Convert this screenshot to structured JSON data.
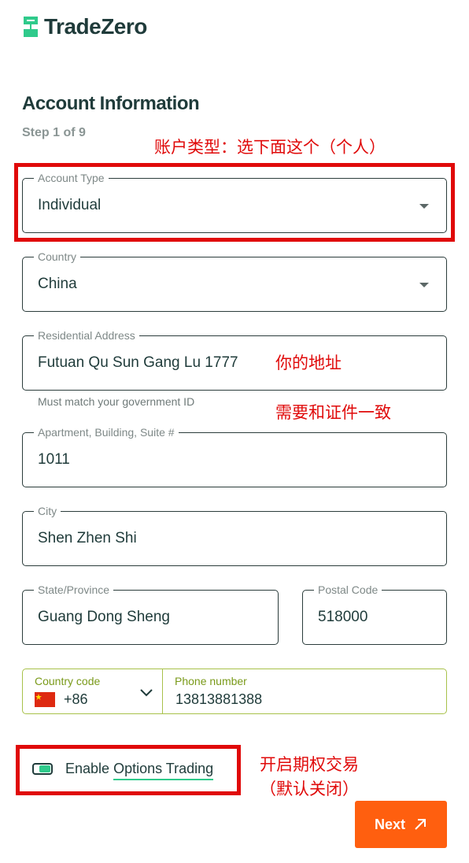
{
  "brand": {
    "name": "TradeZero",
    "accent": "#2fca8b",
    "text_color": "#1f3b3a"
  },
  "header": {
    "title": "Account Information",
    "step": "Step 1 of 9"
  },
  "form": {
    "account_type": {
      "label": "Account Type",
      "value": "Individual"
    },
    "country": {
      "label": "Country",
      "value": "China"
    },
    "residential_address": {
      "label": "Residential Address",
      "value": "Futuan Qu Sun Gang Lu 1777",
      "helper": "Must match your government ID"
    },
    "apartment": {
      "label": "Apartment, Building, Suite #",
      "value": "1011"
    },
    "city": {
      "label": "City",
      "value": "Shen Zhen Shi"
    },
    "state": {
      "label": "State/Province",
      "value": "Guang Dong Sheng"
    },
    "postal_code": {
      "label": "Postal Code",
      "value": "518000"
    },
    "phone": {
      "country_code_label": "Country code",
      "country_code": "+86",
      "number_label": "Phone number",
      "number": "13813881388",
      "flag_icon": "china-flag-icon"
    },
    "options_trading": {
      "label_prefix": "Enable",
      "label_link": "Options Trading",
      "enabled": true
    }
  },
  "actions": {
    "next_label": "Next",
    "next_color": "#ff5f0f"
  },
  "annotations": {
    "account_type_note": "账户类型：选下面这个（个人）",
    "address_note": "你的地址",
    "id_note": "需要和证件一致",
    "options_note_line1": "开启期权交易",
    "options_note_line2": "（默认关闭）",
    "color": "#e00a0a"
  }
}
